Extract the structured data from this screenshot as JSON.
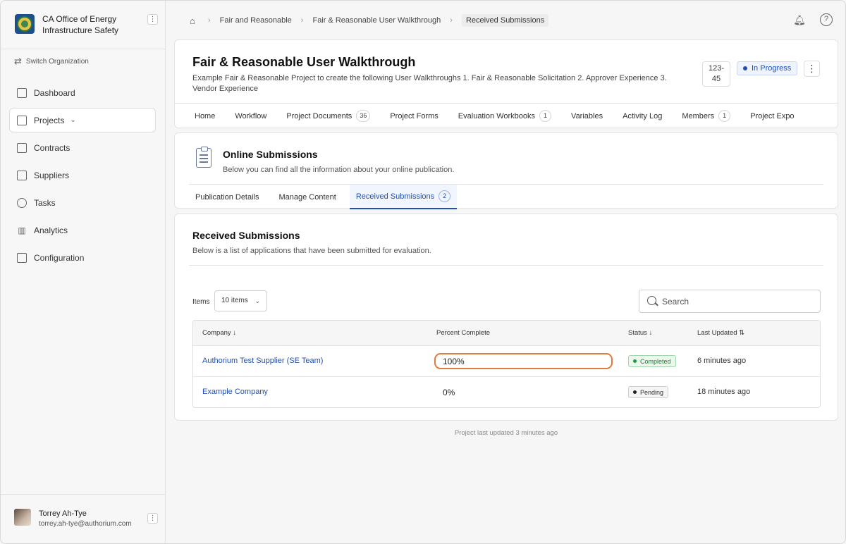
{
  "org": {
    "name": "CA Office of Energy Infrastructure Safety",
    "switch_label": "Switch Organization"
  },
  "nav": {
    "items": [
      {
        "label": "Dashboard",
        "icon": "dashboard-icon"
      },
      {
        "label": "Projects",
        "icon": "briefcase-icon",
        "active": true
      },
      {
        "label": "Contracts",
        "icon": "contract-icon"
      },
      {
        "label": "Suppliers",
        "icon": "building-icon"
      },
      {
        "label": "Tasks",
        "icon": "check-circle-icon"
      },
      {
        "label": "Analytics",
        "icon": "bar-chart-icon"
      },
      {
        "label": "Configuration",
        "icon": "settings-list-icon"
      }
    ]
  },
  "user": {
    "name": "Torrey Ah-Tye",
    "email": "torrey.ah-tye@authorium.com"
  },
  "breadcrumbs": [
    "Fair and Reasonable",
    "Fair & Reasonable User Walkthrough",
    "Received Submissions"
  ],
  "project": {
    "title": "Fair & Reasonable User Walkthrough",
    "description": "Example Fair & Reasonable Project to create the following User Walkthroughs 1. Fair & Reasonable Solicitation 2. Approver Experience 3. Vendor Experience",
    "number": "123-\n45",
    "status": "In Progress",
    "tabs": [
      {
        "label": "Home",
        "count": ""
      },
      {
        "label": "Workflow",
        "count": ""
      },
      {
        "label": "Project Documents",
        "count": "36"
      },
      {
        "label": "Project Forms",
        "count": ""
      },
      {
        "label": "Evaluation Workbooks",
        "count": "1"
      },
      {
        "label": "Variables",
        "count": ""
      },
      {
        "label": "Activity Log",
        "count": ""
      },
      {
        "label": "Members",
        "count": "1"
      },
      {
        "label": "Project Expo",
        "count": ""
      }
    ]
  },
  "online": {
    "title": "Online Submissions",
    "description": "Below you can find all the information about your online publication.",
    "tabs": [
      {
        "label": "Publication Details",
        "count": ""
      },
      {
        "label": "Manage Content",
        "count": ""
      },
      {
        "label": "Received Submissions",
        "count": "2",
        "active": true
      }
    ]
  },
  "received": {
    "title": "Received Submissions",
    "description": "Below is a list of applications that have been submitted for evaluation.",
    "items_label": "Items",
    "items_value": "10 items",
    "search_placeholder": "Search",
    "columns": [
      "Company",
      "Percent Complete",
      "Status",
      "Last Updated"
    ],
    "rows": [
      {
        "company": "Authorium Test Supplier (SE Team)",
        "percent": "100%",
        "status": "Completed",
        "updated": "6 minutes ago"
      },
      {
        "company": "Example Company",
        "percent": "0%",
        "status": "Pending",
        "updated": "18 minutes ago"
      }
    ]
  },
  "footer": "Project last updated 3 minutes ago",
  "colors": {
    "accent": "#1f4fb5",
    "highlight": "#e07a3d",
    "completed": "#1e7a35"
  }
}
